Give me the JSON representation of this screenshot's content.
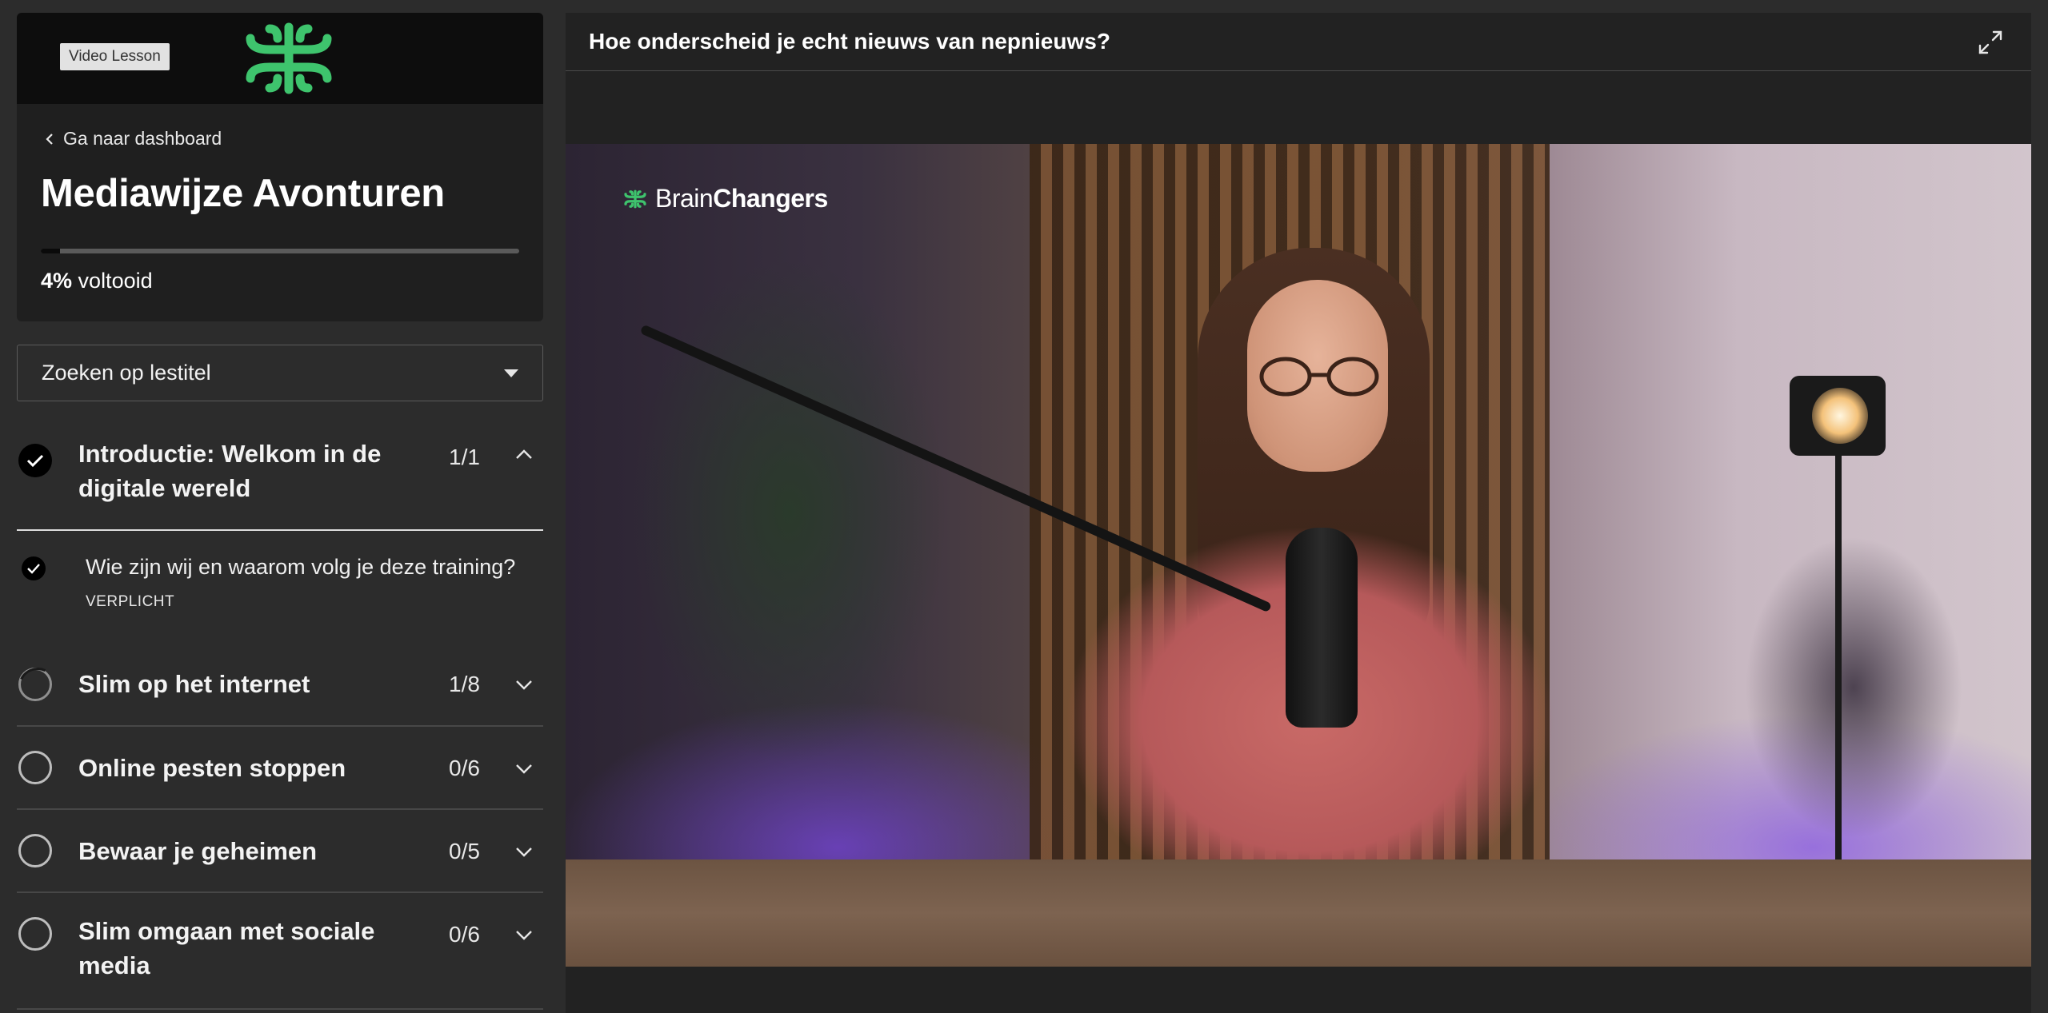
{
  "header": {
    "badge": "Video Lesson",
    "brand_color": "#3ec46d"
  },
  "course": {
    "back_label": "Ga naar dashboard",
    "title": "Mediawijze Avonturen",
    "progress_percent": 4,
    "progress_value": "4%",
    "progress_suffix": "voltooid"
  },
  "search": {
    "placeholder": "Zoeken op lestitel"
  },
  "sections": [
    {
      "title": "Introductie: Welkom in de digitale wereld",
      "count": "1/1",
      "status": "complete",
      "expanded": true,
      "lessons": [
        {
          "title": "Wie zijn wij en waarom volg je deze training?",
          "tag": "VERPLICHT",
          "status": "complete"
        }
      ]
    },
    {
      "title": "Slim op het internet",
      "count": "1/8",
      "status": "in-progress",
      "expanded": false
    },
    {
      "title": "Online pesten stoppen",
      "count": "0/6",
      "status": "not-started",
      "expanded": false
    },
    {
      "title": "Bewaar je geheimen",
      "count": "0/5",
      "status": "not-started",
      "expanded": false
    },
    {
      "title": "Slim omgaan met sociale media",
      "count": "0/6",
      "status": "not-started",
      "expanded": false
    }
  ],
  "video": {
    "title": "Hoe onderscheid je echt nieuws van nepnieuws?",
    "logo_regular": "Brain",
    "logo_bold": "Changers"
  },
  "icons": {
    "back": "chevron-left-icon",
    "select": "caret-down-icon",
    "expand": "expand-icon",
    "section_open": "chevron-up-icon",
    "section_closed": "chevron-down-icon",
    "complete": "check-circle-icon",
    "progress": "progress-circle-icon",
    "empty": "empty-circle-icon"
  }
}
